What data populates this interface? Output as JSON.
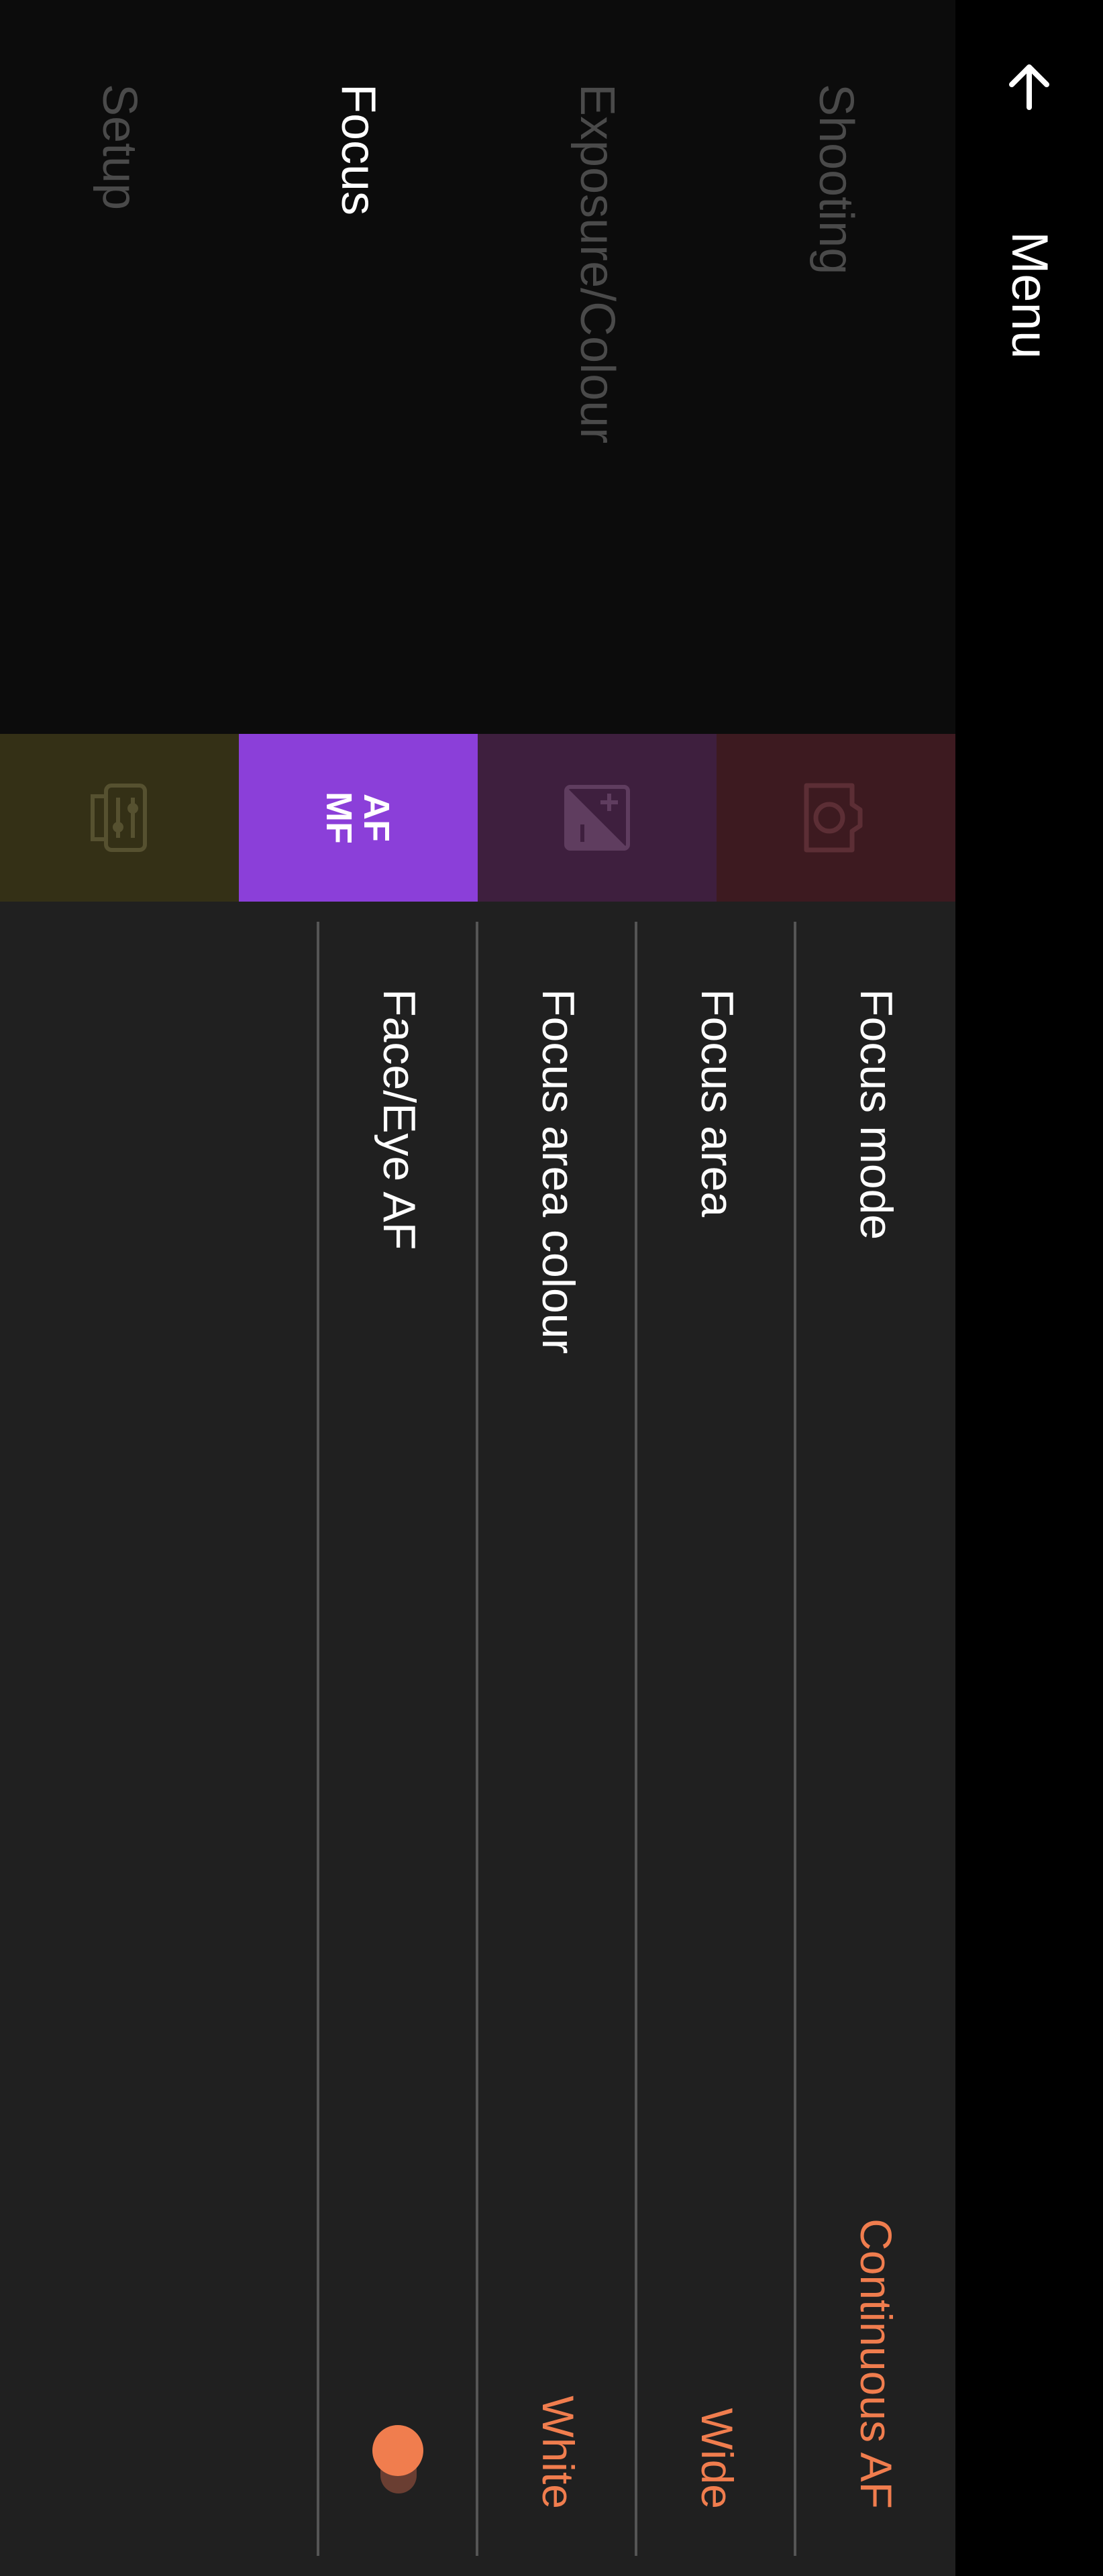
{
  "header": {
    "title": "Menu",
    "back_icon": "arrow-back-icon"
  },
  "tabs": [
    {
      "label": "Shooting",
      "icon": "camera-icon",
      "active": false,
      "tile_color": "#3d1a20",
      "icon_color": "#5c2e35"
    },
    {
      "label": "Exposure/Colour",
      "icon": "exposure-compensation-icon",
      "active": false,
      "tile_color": "#3e1f3e",
      "icon_color": "#5f3d5f"
    },
    {
      "label": "Focus",
      "icon": "af-mf-icon",
      "icon_text_top": "AF",
      "icon_text_bottom": "MF",
      "active": true,
      "tile_color": "#8b3fd9",
      "icon_color": "#ffffff"
    },
    {
      "label": "Setup",
      "icon": "setup-sliders-icon",
      "active": false,
      "tile_color": "#343016",
      "icon_color": "#565130"
    }
  ],
  "settings": [
    {
      "label": "Focus mode",
      "value": "Continuous AF"
    },
    {
      "label": "Focus area",
      "value": "Wide"
    },
    {
      "label": "Focus area colour",
      "value": "White"
    },
    {
      "label": "Face/Eye AF",
      "toggle": true
    }
  ],
  "colors": {
    "accent": "#f07d4e",
    "toggle_track": "#6a3e32"
  }
}
